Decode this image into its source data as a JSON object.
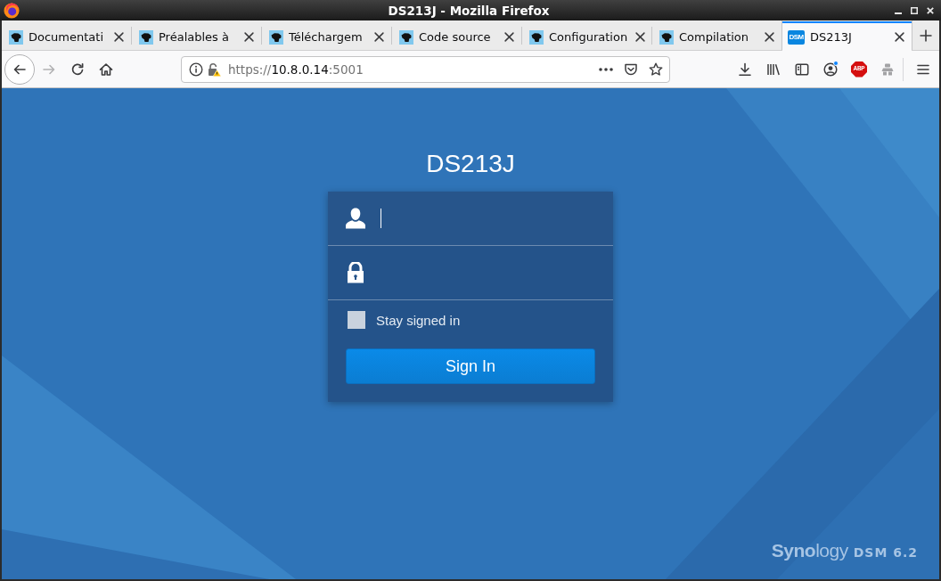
{
  "window": {
    "title": "DS213J - Mozilla Firefox"
  },
  "tabs": [
    {
      "label": "Documentati",
      "kind": "page",
      "selected": false
    },
    {
      "label": "Préalables à",
      "kind": "page",
      "selected": false
    },
    {
      "label": "Téléchargem",
      "kind": "page",
      "selected": false
    },
    {
      "label": "Code source",
      "kind": "page",
      "selected": false
    },
    {
      "label": "Configuration",
      "kind": "page",
      "selected": false
    },
    {
      "label": "Compilation",
      "kind": "page",
      "selected": false
    },
    {
      "label": "DS213J",
      "kind": "dsm",
      "favicon_text": "DSM",
      "selected": true
    }
  ],
  "toolbar": {
    "nav_buttons": [
      {
        "kind": "back",
        "disabled": false
      },
      {
        "kind": "forward",
        "disabled": true
      },
      {
        "kind": "reload",
        "disabled": false
      },
      {
        "kind": "home",
        "disabled": false
      }
    ],
    "address": {
      "scheme": "https://",
      "host": "10.8.0.14",
      "port": ":5001"
    },
    "account_badge": true,
    "adblock_label": "ABP"
  },
  "login": {
    "title": "DS213J",
    "fields": [
      {
        "kind": "username",
        "focused": true
      },
      {
        "kind": "password",
        "focused": false
      }
    ],
    "stay_signed_in": {
      "label": "Stay signed in",
      "checked": false
    },
    "submit": "Sign In"
  },
  "footer": {
    "brand": "**Syno**logy",
    "product": "DSM 6.2"
  }
}
